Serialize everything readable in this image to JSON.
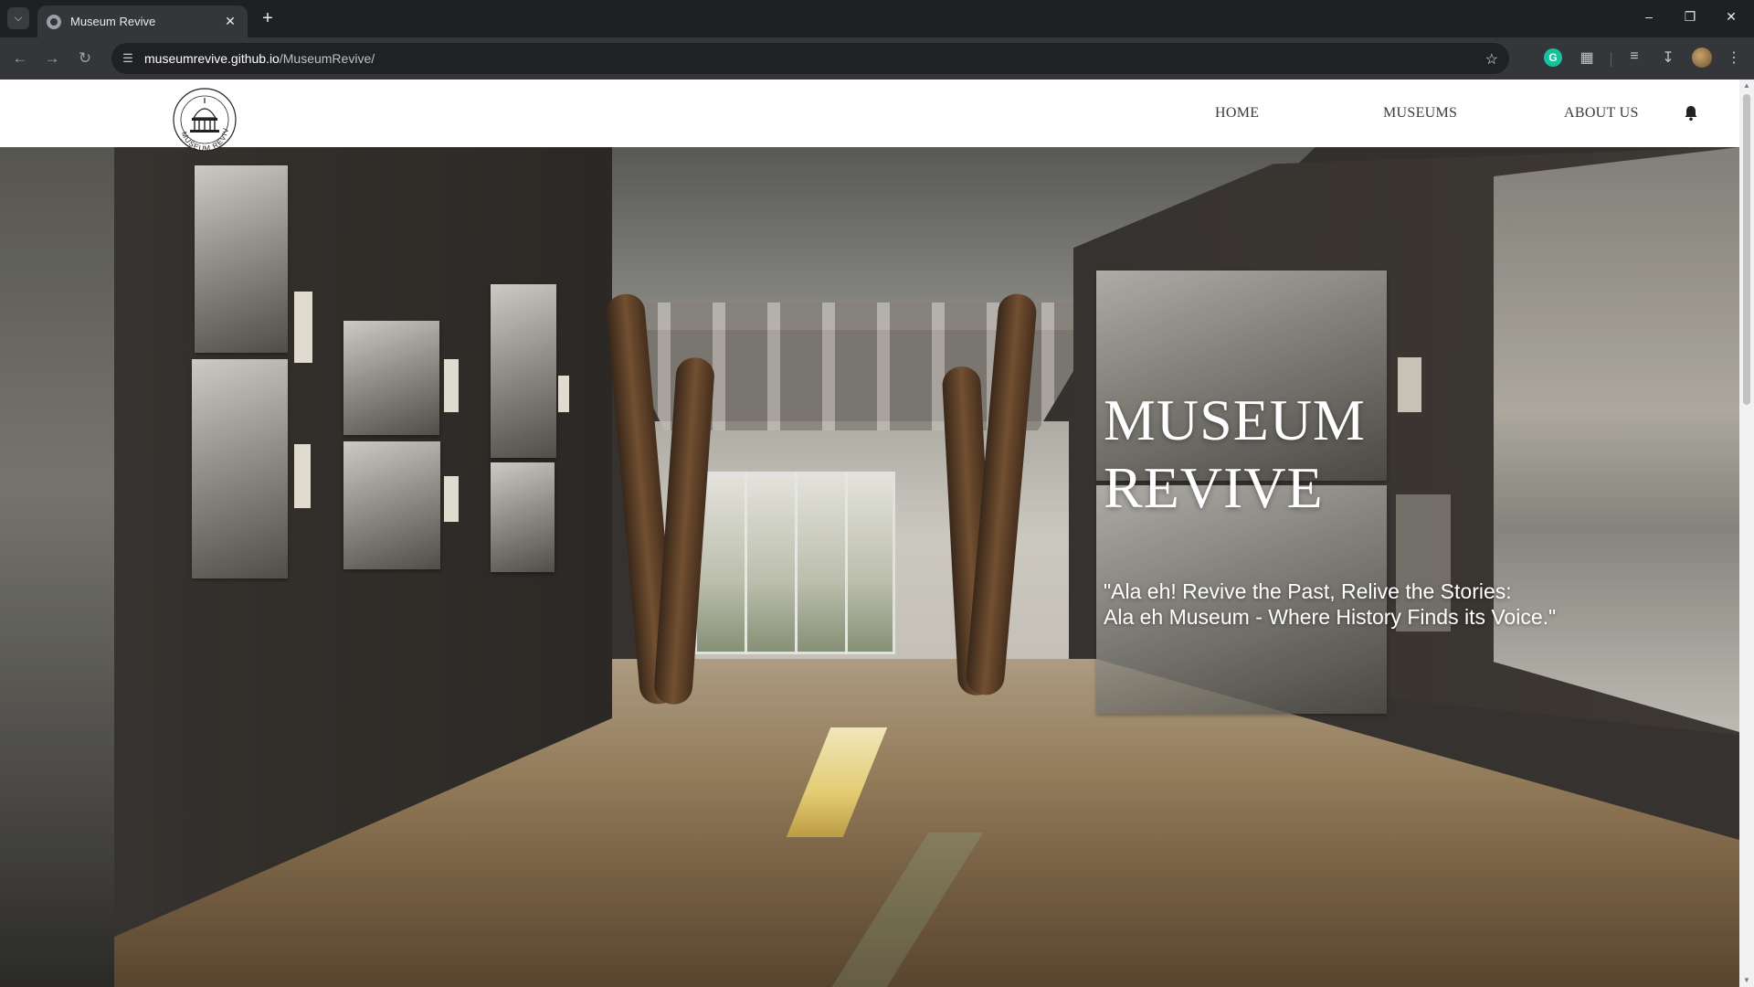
{
  "browser": {
    "tab_title": "Museum Revive",
    "url_host": "museumrevive.github.io",
    "url_path": "/MuseumRevive/",
    "icons": [
      "tab-search-icon",
      "favicon",
      "close-icon",
      "new-tab-icon",
      "minimize-icon",
      "restore-icon",
      "window-close-icon",
      "back-icon",
      "forward-icon",
      "reload-icon",
      "site-info-icon",
      "bookmark-star-icon",
      "grammarly-icon",
      "extensions-icon",
      "reading-list-icon",
      "downloads-icon",
      "profile-avatar",
      "menu-icon"
    ]
  },
  "site": {
    "logo_text": "MUSEUM REVIVE",
    "nav": [
      {
        "label": "HOME"
      },
      {
        "label": "MUSEUMS"
      },
      {
        "label": "ABOUT US"
      }
    ],
    "notification_icon": "bell-icon",
    "hero": {
      "title_line1": "MUSEUM",
      "title_line2": "REVIVE",
      "tagline_line1": "\"Ala eh! Revive the Past, Relive the Stories:",
      "tagline_line2": "Ala eh Museum - Where History Finds its Voice.\""
    }
  }
}
